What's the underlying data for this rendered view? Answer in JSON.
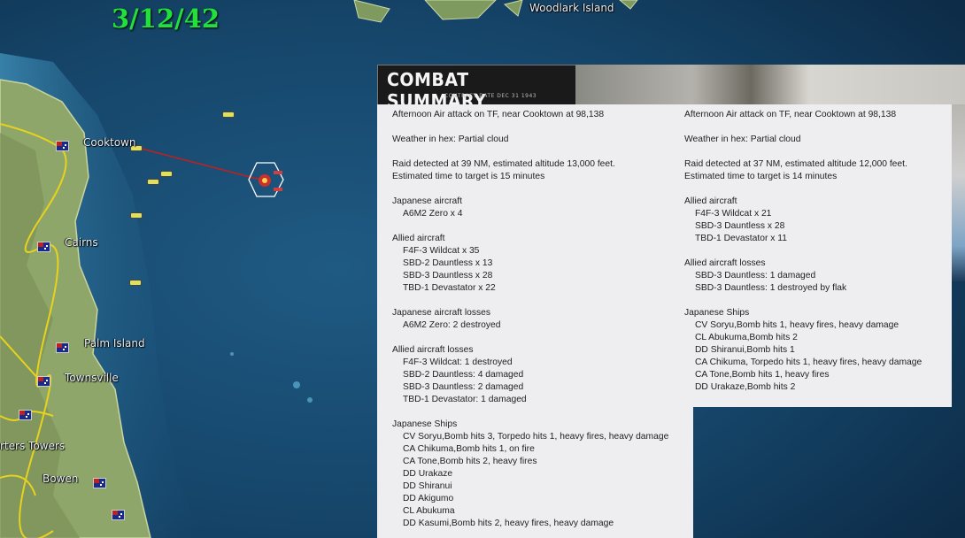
{
  "game_date": "3/12/42",
  "map": {
    "places": [
      {
        "name": "Woodlark Island"
      },
      {
        "name": "Cooktown"
      },
      {
        "name": "Cairns"
      },
      {
        "name": "Palm Island"
      },
      {
        "name": "Townsville"
      },
      {
        "name": "rters Towers"
      },
      {
        "name": "Bowen"
      }
    ]
  },
  "combat_summary": {
    "title": "COMBAT SUMMARY",
    "subtitle": "CONTRACT DATE DEC 31 1943",
    "reports": [
      {
        "header": "Afternoon Air attack on TF, near Cooktown at 98,138",
        "weather": "Weather in hex: Partial cloud",
        "raid_1": "Raid detected at 39 NM, estimated altitude 13,000 feet.",
        "raid_2": "Estimated time to target is 15 minutes",
        "japanese_aircraft_label": "Japanese aircraft",
        "japanese_aircraft": [
          "A6M2 Zero x 4"
        ],
        "allied_aircraft_label": "Allied aircraft",
        "allied_aircraft": [
          "F4F-3 Wildcat x 35",
          "SBD-2 Dauntless x 13",
          "SBD-3 Dauntless x 28",
          "TBD-1 Devastator x 22"
        ],
        "japanese_losses_label": "Japanese aircraft losses",
        "japanese_losses": [
          "A6M2 Zero: 2 destroyed"
        ],
        "allied_losses_label": "Allied aircraft losses",
        "allied_losses": [
          "F4F-3 Wildcat: 1 destroyed",
          "SBD-2 Dauntless: 4 damaged",
          "SBD-3 Dauntless: 2 damaged",
          "TBD-1 Devastator: 1 damaged"
        ],
        "ships_label": "Japanese Ships",
        "ships": [
          "CV Soryu,Bomb hits 3, Torpedo hits 1,  heavy fires,  heavy damage",
          "CA Chikuma,Bomb hits 1,  on fire",
          "CA Tone,Bomb hits 2,  heavy fires",
          "DD Urakaze",
          "DD Shiranui",
          "DD Akigumo",
          "CL Abukuma",
          "DD Kasumi,Bomb hits 2,  heavy fires,  heavy damage"
        ]
      },
      {
        "header": "Afternoon Air attack on TF, near Cooktown at 98,138",
        "weather": "Weather in hex: Partial cloud",
        "raid_1": "Raid detected at 37 NM, estimated altitude 12,000 feet.",
        "raid_2": "Estimated time to target is 14 minutes",
        "allied_aircraft_label": "Allied aircraft",
        "allied_aircraft": [
          "F4F-3 Wildcat x 21",
          "SBD-3 Dauntless x 28",
          "TBD-1 Devastator x 11"
        ],
        "allied_losses_label": "Allied aircraft losses",
        "allied_losses": [
          "SBD-3 Dauntless: 1 damaged",
          "SBD-3 Dauntless: 1 destroyed by flak"
        ],
        "ships_label": "Japanese Ships",
        "ships": [
          "CV Soryu,Bomb hits 1,  heavy fires,  heavy damage",
          "CL Abukuma,Bomb hits 2",
          "DD Shiranui,Bomb hits 1",
          "CA Chikuma, Torpedo hits 1,  heavy fires,  heavy damage",
          "CA Tone,Bomb hits 1,  heavy fires",
          "DD Urakaze,Bomb hits 2"
        ]
      }
    ]
  },
  "colors": {
    "date_text": "#22e03a",
    "ocean_deep": "#10324f",
    "ocean_shallow": "#2a6a94",
    "land": "#8fa66a",
    "raid_line": "#c02020",
    "panel_bg": "#eeeef0"
  }
}
